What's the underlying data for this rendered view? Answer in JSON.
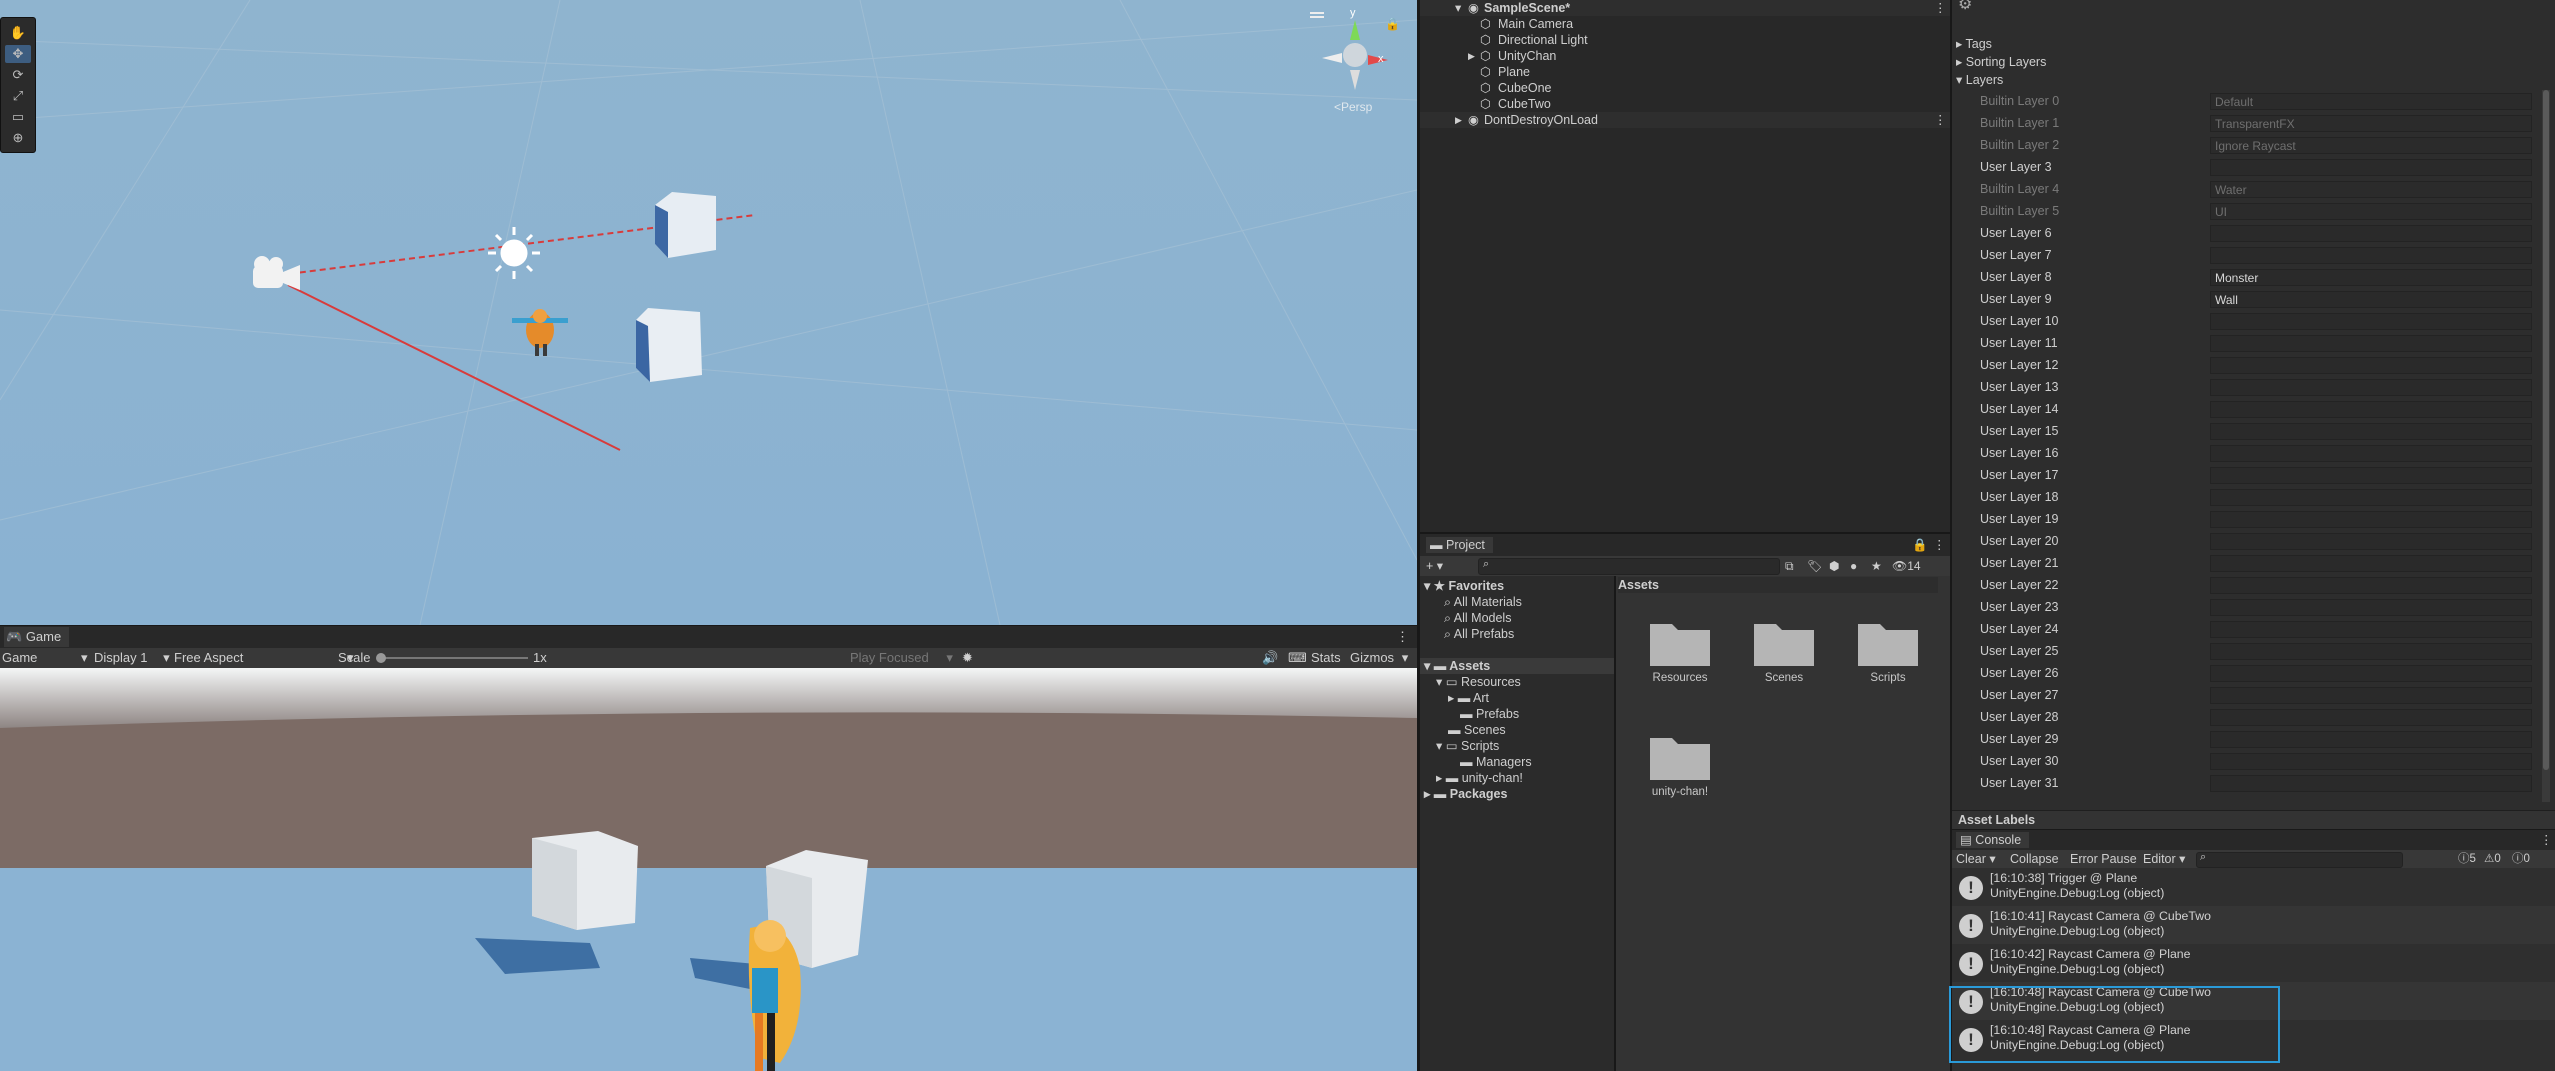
{
  "scene_view": {
    "persp_label": "<Persp",
    "tools": [
      "hand-tool",
      "move-tool",
      "rotate-tool",
      "scale-tool",
      "rect-tool",
      "transform-tool"
    ]
  },
  "game_view": {
    "tab_label": "Game",
    "mode_dropdown": "Game",
    "display_dropdown": "Display 1",
    "aspect_dropdown": "Free Aspect",
    "scale_label": "Scale",
    "scale_value": "1x",
    "play_focused": "Play Focused",
    "stats": "Stats",
    "gizmos": "Gizmos"
  },
  "hierarchy": {
    "scene_name": "SampleScene*",
    "items": [
      "Main Camera",
      "Directional Light",
      "UnityChan",
      "Plane",
      "CubeOne",
      "CubeTwo"
    ],
    "dont_destroy": "DontDestroyOnLoad"
  },
  "project": {
    "tab_label": "Project",
    "hidden_count": "14",
    "favorites_label": "Favorites",
    "favorites": [
      "All Materials",
      "All Models",
      "All Prefabs"
    ],
    "assets_label": "Assets",
    "tree": {
      "resources": "Resources",
      "art": "Art",
      "prefabs": "Prefabs",
      "scenes": "Scenes",
      "scripts": "Scripts",
      "managers": "Managers",
      "unitychan": "unity-chan!",
      "packages": "Packages"
    },
    "grid_header": "Assets",
    "folders": [
      "Resources",
      "Scenes",
      "Scripts",
      "unity-chan!"
    ]
  },
  "inspector": {
    "tags": "Tags",
    "sorting_layers": "Sorting Layers",
    "layers_label": "Layers",
    "layers": [
      {
        "name": "Builtin Layer 0",
        "value": "Default",
        "builtin": true
      },
      {
        "name": "Builtin Layer 1",
        "value": "TransparentFX",
        "builtin": true
      },
      {
        "name": "Builtin Layer 2",
        "value": "Ignore Raycast",
        "builtin": true
      },
      {
        "name": "User Layer 3",
        "value": "",
        "builtin": false
      },
      {
        "name": "Builtin Layer 4",
        "value": "Water",
        "builtin": true
      },
      {
        "name": "Builtin Layer 5",
        "value": "UI",
        "builtin": true
      },
      {
        "name": "User Layer 6",
        "value": "",
        "builtin": false
      },
      {
        "name": "User Layer 7",
        "value": "",
        "builtin": false
      },
      {
        "name": "User Layer 8",
        "value": "Monster",
        "builtin": false
      },
      {
        "name": "User Layer 9",
        "value": "Wall",
        "builtin": false
      },
      {
        "name": "User Layer 10",
        "value": "",
        "builtin": false
      },
      {
        "name": "User Layer 11",
        "value": "",
        "builtin": false
      },
      {
        "name": "User Layer 12",
        "value": "",
        "builtin": false
      },
      {
        "name": "User Layer 13",
        "value": "",
        "builtin": false
      },
      {
        "name": "User Layer 14",
        "value": "",
        "builtin": false
      },
      {
        "name": "User Layer 15",
        "value": "",
        "builtin": false
      },
      {
        "name": "User Layer 16",
        "value": "",
        "builtin": false
      },
      {
        "name": "User Layer 17",
        "value": "",
        "builtin": false
      },
      {
        "name": "User Layer 18",
        "value": "",
        "builtin": false
      },
      {
        "name": "User Layer 19",
        "value": "",
        "builtin": false
      },
      {
        "name": "User Layer 20",
        "value": "",
        "builtin": false
      },
      {
        "name": "User Layer 21",
        "value": "",
        "builtin": false
      },
      {
        "name": "User Layer 22",
        "value": "",
        "builtin": false
      },
      {
        "name": "User Layer 23",
        "value": "",
        "builtin": false
      },
      {
        "name": "User Layer 24",
        "value": "",
        "builtin": false
      },
      {
        "name": "User Layer 25",
        "value": "",
        "builtin": false
      },
      {
        "name": "User Layer 26",
        "value": "",
        "builtin": false
      },
      {
        "name": "User Layer 27",
        "value": "",
        "builtin": false
      },
      {
        "name": "User Layer 28",
        "value": "",
        "builtin": false
      },
      {
        "name": "User Layer 29",
        "value": "",
        "builtin": false
      },
      {
        "name": "User Layer 30",
        "value": "",
        "builtin": false
      },
      {
        "name": "User Layer 31",
        "value": "",
        "builtin": false
      }
    ],
    "asset_labels": "Asset Labels"
  },
  "console": {
    "tab_label": "Console",
    "clear": "Clear",
    "collapse": "Collapse",
    "error_pause": "Error Pause",
    "editor": "Editor",
    "log_count": "5",
    "warn_count": "0",
    "error_count": "0",
    "entries": [
      {
        "line1": "[16:10:38] Trigger @ Plane",
        "line2": "UnityEngine.Debug:Log (object)"
      },
      {
        "line1": "[16:10:41] Raycast Camera @ CubeTwo",
        "line2": "UnityEngine.Debug:Log (object)"
      },
      {
        "line1": "[16:10:42] Raycast Camera @ Plane",
        "line2": "UnityEngine.Debug:Log (object)"
      },
      {
        "line1": "[16:10:48] Raycast Camera @ CubeTwo",
        "line2": "UnityEngine.Debug:Log (object)"
      },
      {
        "line1": "[16:10:48] Raycast Camera @ Plane",
        "line2": "UnityEngine.Debug:Log (object)"
      }
    ]
  }
}
